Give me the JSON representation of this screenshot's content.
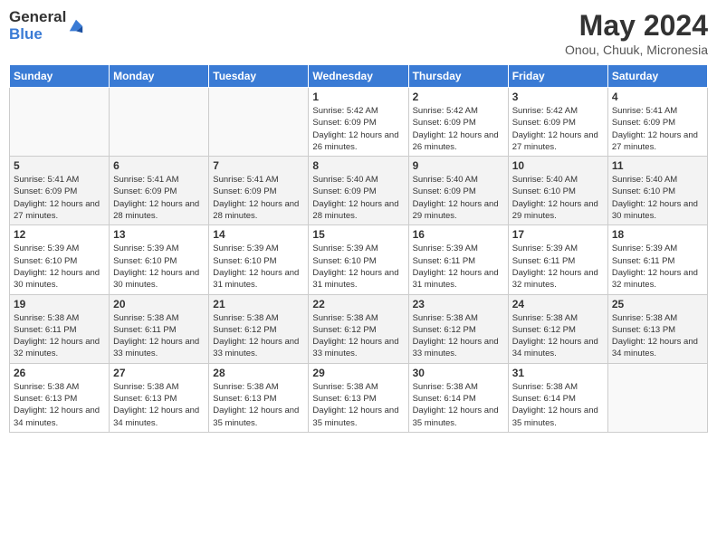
{
  "logo": {
    "general": "General",
    "blue": "Blue"
  },
  "title": "May 2024",
  "location": "Onou, Chuuk, Micronesia",
  "days_of_week": [
    "Sunday",
    "Monday",
    "Tuesday",
    "Wednesday",
    "Thursday",
    "Friday",
    "Saturday"
  ],
  "weeks": [
    [
      {
        "day": "",
        "info": ""
      },
      {
        "day": "",
        "info": ""
      },
      {
        "day": "",
        "info": ""
      },
      {
        "day": "1",
        "info": "Sunrise: 5:42 AM\nSunset: 6:09 PM\nDaylight: 12 hours and 26 minutes."
      },
      {
        "day": "2",
        "info": "Sunrise: 5:42 AM\nSunset: 6:09 PM\nDaylight: 12 hours and 26 minutes."
      },
      {
        "day": "3",
        "info": "Sunrise: 5:42 AM\nSunset: 6:09 PM\nDaylight: 12 hours and 27 minutes."
      },
      {
        "day": "4",
        "info": "Sunrise: 5:41 AM\nSunset: 6:09 PM\nDaylight: 12 hours and 27 minutes."
      }
    ],
    [
      {
        "day": "5",
        "info": "Sunrise: 5:41 AM\nSunset: 6:09 PM\nDaylight: 12 hours and 27 minutes."
      },
      {
        "day": "6",
        "info": "Sunrise: 5:41 AM\nSunset: 6:09 PM\nDaylight: 12 hours and 28 minutes."
      },
      {
        "day": "7",
        "info": "Sunrise: 5:41 AM\nSunset: 6:09 PM\nDaylight: 12 hours and 28 minutes."
      },
      {
        "day": "8",
        "info": "Sunrise: 5:40 AM\nSunset: 6:09 PM\nDaylight: 12 hours and 28 minutes."
      },
      {
        "day": "9",
        "info": "Sunrise: 5:40 AM\nSunset: 6:09 PM\nDaylight: 12 hours and 29 minutes."
      },
      {
        "day": "10",
        "info": "Sunrise: 5:40 AM\nSunset: 6:10 PM\nDaylight: 12 hours and 29 minutes."
      },
      {
        "day": "11",
        "info": "Sunrise: 5:40 AM\nSunset: 6:10 PM\nDaylight: 12 hours and 30 minutes."
      }
    ],
    [
      {
        "day": "12",
        "info": "Sunrise: 5:39 AM\nSunset: 6:10 PM\nDaylight: 12 hours and 30 minutes."
      },
      {
        "day": "13",
        "info": "Sunrise: 5:39 AM\nSunset: 6:10 PM\nDaylight: 12 hours and 30 minutes."
      },
      {
        "day": "14",
        "info": "Sunrise: 5:39 AM\nSunset: 6:10 PM\nDaylight: 12 hours and 31 minutes."
      },
      {
        "day": "15",
        "info": "Sunrise: 5:39 AM\nSunset: 6:10 PM\nDaylight: 12 hours and 31 minutes."
      },
      {
        "day": "16",
        "info": "Sunrise: 5:39 AM\nSunset: 6:11 PM\nDaylight: 12 hours and 31 minutes."
      },
      {
        "day": "17",
        "info": "Sunrise: 5:39 AM\nSunset: 6:11 PM\nDaylight: 12 hours and 32 minutes."
      },
      {
        "day": "18",
        "info": "Sunrise: 5:39 AM\nSunset: 6:11 PM\nDaylight: 12 hours and 32 minutes."
      }
    ],
    [
      {
        "day": "19",
        "info": "Sunrise: 5:38 AM\nSunset: 6:11 PM\nDaylight: 12 hours and 32 minutes."
      },
      {
        "day": "20",
        "info": "Sunrise: 5:38 AM\nSunset: 6:11 PM\nDaylight: 12 hours and 33 minutes."
      },
      {
        "day": "21",
        "info": "Sunrise: 5:38 AM\nSunset: 6:12 PM\nDaylight: 12 hours and 33 minutes."
      },
      {
        "day": "22",
        "info": "Sunrise: 5:38 AM\nSunset: 6:12 PM\nDaylight: 12 hours and 33 minutes."
      },
      {
        "day": "23",
        "info": "Sunrise: 5:38 AM\nSunset: 6:12 PM\nDaylight: 12 hours and 33 minutes."
      },
      {
        "day": "24",
        "info": "Sunrise: 5:38 AM\nSunset: 6:12 PM\nDaylight: 12 hours and 34 minutes."
      },
      {
        "day": "25",
        "info": "Sunrise: 5:38 AM\nSunset: 6:13 PM\nDaylight: 12 hours and 34 minutes."
      }
    ],
    [
      {
        "day": "26",
        "info": "Sunrise: 5:38 AM\nSunset: 6:13 PM\nDaylight: 12 hours and 34 minutes."
      },
      {
        "day": "27",
        "info": "Sunrise: 5:38 AM\nSunset: 6:13 PM\nDaylight: 12 hours and 34 minutes."
      },
      {
        "day": "28",
        "info": "Sunrise: 5:38 AM\nSunset: 6:13 PM\nDaylight: 12 hours and 35 minutes."
      },
      {
        "day": "29",
        "info": "Sunrise: 5:38 AM\nSunset: 6:13 PM\nDaylight: 12 hours and 35 minutes."
      },
      {
        "day": "30",
        "info": "Sunrise: 5:38 AM\nSunset: 6:14 PM\nDaylight: 12 hours and 35 minutes."
      },
      {
        "day": "31",
        "info": "Sunrise: 5:38 AM\nSunset: 6:14 PM\nDaylight: 12 hours and 35 minutes."
      },
      {
        "day": "",
        "info": ""
      }
    ]
  ]
}
